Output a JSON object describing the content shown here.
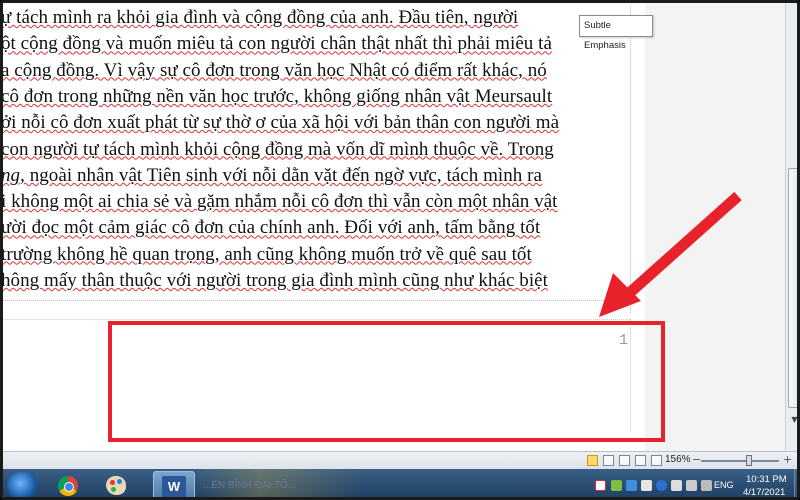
{
  "document": {
    "lines": [
      {
        "segments": [
          {
            "t": "ự tách mình ra khỏi gia đình và cộng đồng của anh. Đầu tiên, người"
          }
        ]
      },
      {
        "segments": [
          {
            "t": "ột cộng đồng và muốn miêu tả con người chân thật nhất thì phải miêu tả"
          }
        ]
      },
      {
        "segments": [
          {
            "t": "a cộng đồng. Vì vậy sự cô đơn trong văn học Nhật có điểm rất khác, nó"
          }
        ]
      },
      {
        "segments": [
          {
            "t": "cô đơn trong những nền văn học trước, không giống nhân vật Meursault"
          }
        ]
      },
      {
        "segments": [
          {
            "t": "ởi nỗi cô đơn xuất phát từ sự thờ ơ của xã hội với bản thân con người  mà"
          }
        ]
      },
      {
        "segments": [
          {
            "t": " con người tự tách mình khỏi cộng đồng mà vốn dĩ mình thuộc về. Trong"
          }
        ]
      },
      {
        "segments": [
          {
            "t": "ng",
            "i": true
          },
          {
            "t": ", ngoài nhân vật Tiên sinh với nỗi dằn vặt đến ngờ vực, tách mình ra"
          }
        ]
      },
      {
        "segments": [
          {
            "t": "i không một ai chia sẻ và gặm nhắm nỗi cô đơn thì vẫn còn một nhân vật"
          }
        ]
      },
      {
        "segments": [
          {
            "t": "ười đọc một cảm giác cô đơn của chính anh. Đối với anh, tấm bằng tốt"
          }
        ]
      },
      {
        "segments": [
          {
            "t": " trường không hề quan trọng, anh cũng không muốn trở về quê sau tốt"
          }
        ]
      },
      {
        "segments": [
          {
            "t": "hông mấy thân thuộc với người trong gia đình mình cũng như khác biệt"
          }
        ]
      }
    ],
    "page_number": "1",
    "tooltip": "Subtle Emphasis"
  },
  "statusbar": {
    "zoom_level": "156%",
    "zoom_fraction": 0.62,
    "zoom_minus": "−",
    "zoom_plus": "+"
  },
  "taskbar": {
    "banner_text": "...EN BÌNH ĐẠI TÔ...",
    "language": "ENG",
    "clock_time": "10:31 PM",
    "clock_date": "4/17/2021"
  },
  "annotations": {
    "highlight_color": "#e8222b",
    "arrow_color": "#e8222b"
  },
  "icons": {
    "start": "windows-start-icon",
    "chrome": "chrome-icon",
    "paint": "paint-icon",
    "word": "word-icon"
  }
}
